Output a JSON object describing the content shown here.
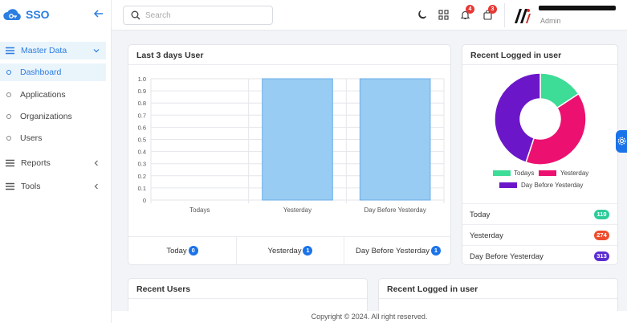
{
  "brand": {
    "name": "SSO"
  },
  "sidebar": {
    "master": {
      "label": "Master Data"
    },
    "subitems": [
      {
        "label": "Dashboard",
        "active": true
      },
      {
        "label": "Applications"
      },
      {
        "label": "Organizations"
      },
      {
        "label": "Users"
      }
    ],
    "reports": {
      "label": "Reports"
    },
    "tools": {
      "label": "Tools"
    }
  },
  "topbar": {
    "search_placeholder": "Search",
    "notifications_count": "4",
    "cart_count": "3",
    "user_role": "Admin"
  },
  "last3": {
    "title": "Last 3 days User",
    "stats": [
      {
        "label": "Today",
        "value": "0"
      },
      {
        "label": "Yesterday",
        "value": "1"
      },
      {
        "label": "Day Before Yesterday",
        "value": "1"
      }
    ]
  },
  "chart_data": [
    {
      "type": "bar",
      "title": "Last 3 days User",
      "categories": [
        "Todays",
        "Yesterday",
        "Day Before Yesterday"
      ],
      "values": [
        0,
        1,
        1
      ],
      "ylim": [
        0,
        1
      ],
      "yticks": [
        "0",
        "0.1",
        "0.2",
        "0.3",
        "0.4",
        "0.5",
        "0.6",
        "0.7",
        "0.8",
        "0.9",
        "1.0"
      ],
      "bar_color": "#99ccf2",
      "bar_border": "#6aaee8",
      "grid": true
    },
    {
      "type": "pie",
      "title": "Recent Logged in user",
      "labels": [
        "Todays",
        "Yesterday",
        "Day Before Yesterday"
      ],
      "values": [
        110,
        274,
        313
      ],
      "colors": [
        "#3ddc97",
        "#ec1170",
        "#6b17c9"
      ],
      "donut": true,
      "legend": "bottom"
    }
  ],
  "recent_logged": {
    "title": "Recent Logged in user",
    "rows": [
      {
        "label": "Today",
        "value": "110",
        "color": "#2ecc9a"
      },
      {
        "label": "Yesterday",
        "value": "274",
        "color": "#ee4d2d"
      },
      {
        "label": "Day Before Yesterday",
        "value": "313",
        "color": "#5b2ed1"
      }
    ]
  },
  "recent_users": {
    "title": "Recent Users"
  },
  "recent_logged_bottom": {
    "title": "Recent Logged in user"
  },
  "footer": {
    "text": "Copyright © 2024. All right reserved."
  }
}
